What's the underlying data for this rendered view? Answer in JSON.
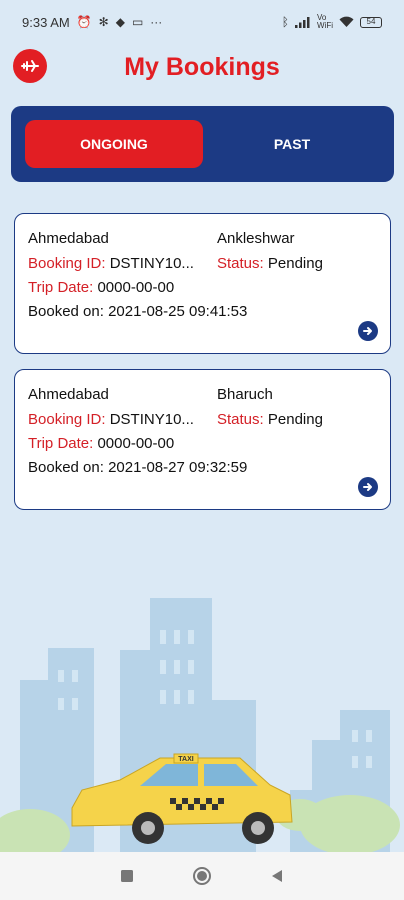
{
  "status_bar": {
    "time": "9:33 AM",
    "icons_left": [
      "alarm-icon",
      "settings-icon",
      "diamond-icon",
      "screen-icon",
      "more-icon"
    ],
    "more_dots": "···",
    "network_label": "Vo\nWiFi",
    "battery": "54"
  },
  "header": {
    "title": "My Bookings",
    "back_icon": "plane-logo-icon"
  },
  "tabs": [
    {
      "label": "ONGOING",
      "active": true
    },
    {
      "label": "PAST",
      "active": false
    }
  ],
  "bookings": [
    {
      "from": "Ahmedabad",
      "to": "Ankleshwar",
      "booking_id_label": "Booking ID:",
      "booking_id": "DSTINY10...",
      "status_label": "Status:",
      "status": "Pending",
      "trip_date_label": "Trip Date:",
      "trip_date": "0000-00-00",
      "booked_on_label": "Booked on:",
      "booked_on": "2021-08-25 09:41:53"
    },
    {
      "from": "Ahmedabad",
      "to": "Bharuch",
      "booking_id_label": "Booking ID:",
      "booking_id": "DSTINY10...",
      "status_label": "Status:",
      "status": "Pending",
      "trip_date_label": "Trip Date:",
      "trip_date": "0000-00-00",
      "booked_on_label": "Booked on:",
      "booked_on": "2021-08-27 09:32:59"
    }
  ],
  "illustration": {
    "taxi_sign": "TAXI"
  },
  "colors": {
    "accent": "#e21e23",
    "navy": "#1c3a84",
    "background": "#dbe9f5"
  }
}
